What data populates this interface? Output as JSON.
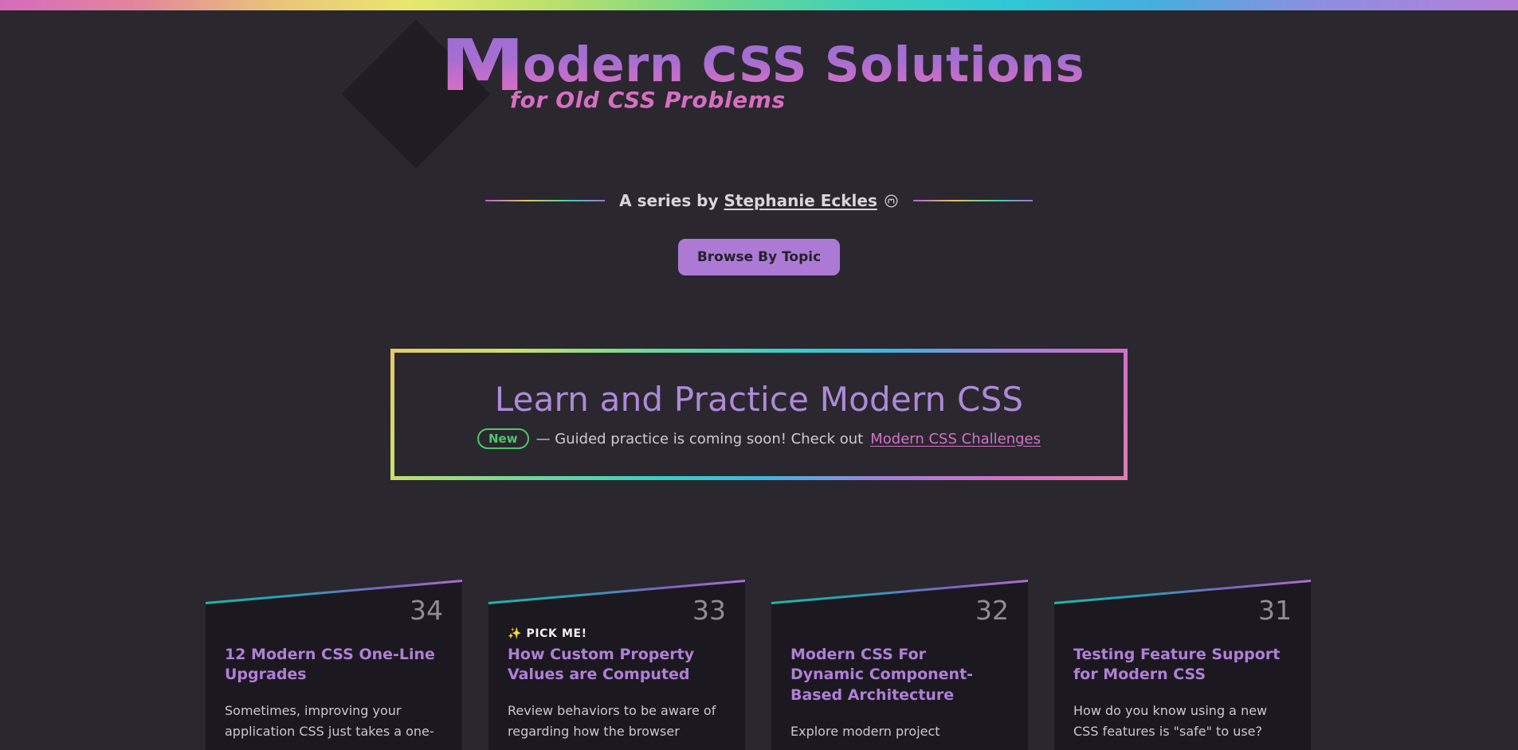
{
  "site": {
    "title_lead": "M",
    "title_rest": "odern CSS Solutions",
    "subtitle": "for Old CSS Problems"
  },
  "byline": {
    "prefix": "A series by ",
    "author": "Stephanie Eckles",
    "social_icon": "mastodon-icon"
  },
  "browse": {
    "label": "Browse By Topic"
  },
  "callout": {
    "title": "Learn and Practice Modern CSS",
    "badge": "New",
    "text": "— Guided practice is coming soon! Check out ",
    "link": "Modern CSS Challenges"
  },
  "cards": [
    {
      "number": "34",
      "flag": "",
      "title": "12 Modern CSS One-Line Upgrades",
      "desc": "Sometimes, improving your application CSS just takes a one-"
    },
    {
      "number": "33",
      "flag": "✨ PICK ME!",
      "title": "How Custom Property Values are Computed",
      "desc": "Review behaviors to be aware of regarding how the browser"
    },
    {
      "number": "32",
      "flag": "",
      "title": "Modern CSS For Dynamic Component-Based Architecture",
      "desc": "Explore modern project"
    },
    {
      "number": "31",
      "flag": "",
      "title": "Testing Feature Support for Modern CSS",
      "desc": "How do you know using a new CSS features is \"safe\" to use?"
    }
  ],
  "colors": {
    "background": "#2a282e",
    "card_background": "#1b191f",
    "accent_purple": "#b07fd8",
    "accent_pink": "#d670c8",
    "badge_green": "#4ec76a",
    "button": "#ac79d5"
  }
}
